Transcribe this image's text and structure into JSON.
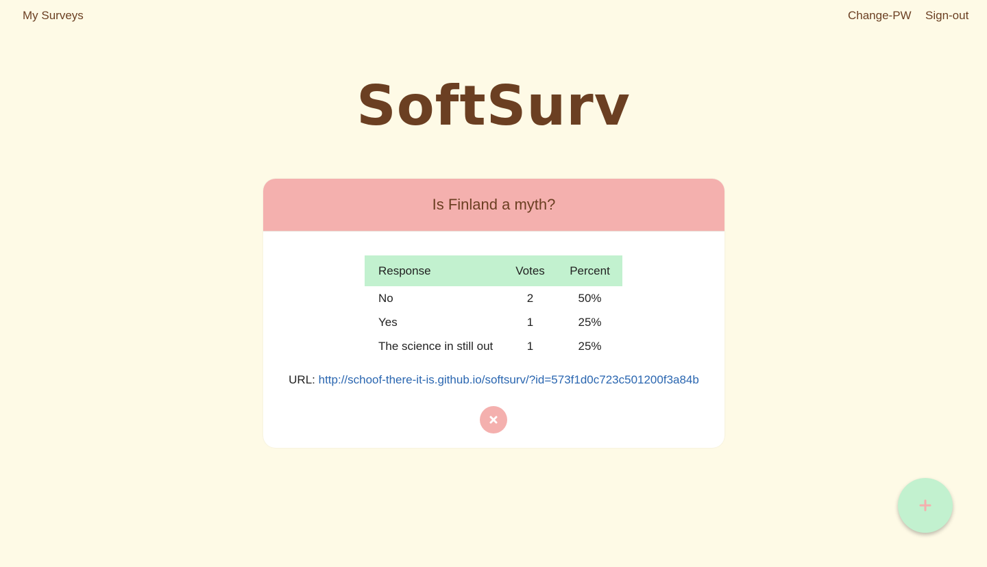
{
  "nav": {
    "left_link": "My Surveys",
    "change_pw": "Change-PW",
    "sign_out": "Sign-out"
  },
  "app": {
    "logo": "SoftSurv"
  },
  "survey": {
    "title": "Is Finland a myth?",
    "columns": [
      "Response",
      "Votes",
      "Percent"
    ],
    "rows": [
      {
        "response": "No",
        "votes": "2",
        "percent": "50%"
      },
      {
        "response": "Yes",
        "votes": "1",
        "percent": "25%"
      },
      {
        "response": "The science in still out",
        "votes": "1",
        "percent": "25%"
      }
    ],
    "url_label": "URL:",
    "url": "http://schoof-there-it-is.github.io/softsurv/?id=573f1d0c723c501200f3a84b"
  },
  "icons": {
    "close": "close-icon",
    "add": "plus-icon"
  },
  "colors": {
    "background": "#fefae6",
    "brand_brown": "#6b3f22",
    "header_pink": "#f4b0ae",
    "table_header_green": "#c2f1cf",
    "link_blue": "#2a66b0"
  }
}
